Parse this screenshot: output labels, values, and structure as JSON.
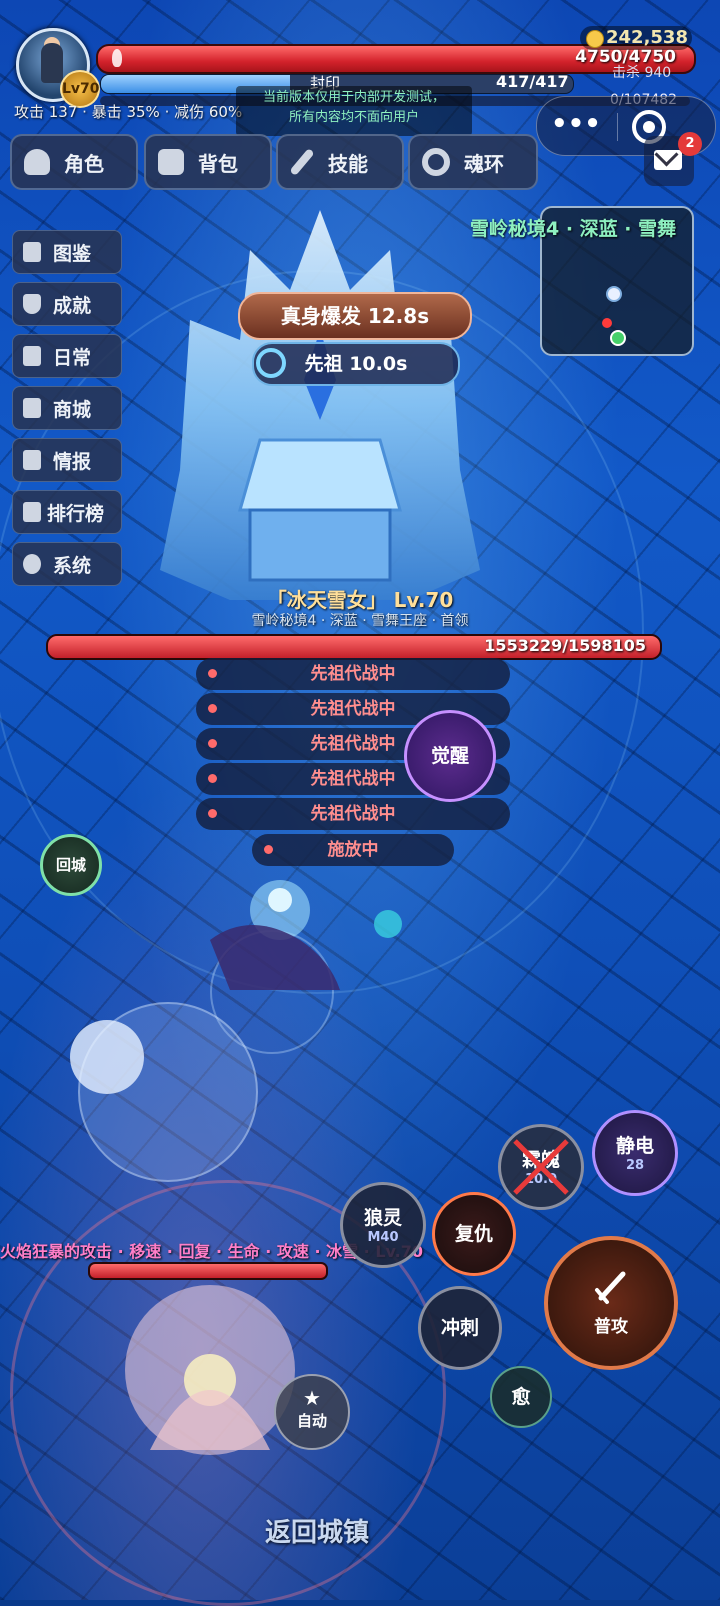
{
  "hud": {
    "level_badge": "Lv70",
    "hp_text": "4750/4750",
    "gold": "242,538",
    "kill_label": "击杀 940",
    "seal_label": "封印",
    "seal_value": "417/417",
    "seal_fraction": 0.4,
    "xp_text": "0/107482",
    "stats_text": "攻击 137  ·  暴击 35%  ·  减伤 60%",
    "notice_line1": "当前版本仅用于内部开发测试，",
    "notice_line2": "所有内容均不面向用户",
    "mail_badge": "2",
    "more_icon": "•••"
  },
  "tabs": [
    {
      "label": "角色",
      "icon": "person-icon"
    },
    {
      "label": "背包",
      "icon": "bag-icon"
    },
    {
      "label": "技能",
      "icon": "wand-icon"
    },
    {
      "label": "魂环",
      "icon": "ring-icon"
    }
  ],
  "left_menu": [
    {
      "label": "图鉴",
      "icon": "book-icon"
    },
    {
      "label": "成就",
      "icon": "trophy-icon"
    },
    {
      "label": "日常",
      "icon": "calendar-icon"
    },
    {
      "label": "商城",
      "icon": "shop-icon"
    },
    {
      "label": "情报",
      "icon": "notes-icon"
    },
    {
      "label": "排行榜",
      "icon": "ranking-icon"
    },
    {
      "label": "系统",
      "icon": "gear-icon"
    }
  ],
  "zone_name": "雪岭秘境4 · 深蓝 · 雪舞",
  "timers": {
    "burst": "真身爆发 12.8s",
    "ancestor": "先祖 10.0s"
  },
  "boss": {
    "name": "「冰天雪女」 Lv.70",
    "subtitle": "雪岭秘境4 · 深蓝 · 雪舞王座 · 首领",
    "hp_text": "1553229/1598105",
    "hp_fraction": 0.972
  },
  "status_list": [
    "先祖代战中",
    "先祖代战中",
    "先祖代战中",
    "先祖代战中",
    "先祖代战中"
  ],
  "casting_label": "施放中",
  "awaken_label": "觉醒",
  "return_city_label": "回城",
  "skills": {
    "soul": {
      "label": "霖魄",
      "sub": "10.0"
    },
    "static": {
      "label": "静电",
      "sub": "28"
    },
    "wolf": {
      "label": "狼灵",
      "sub": "M40"
    },
    "revenge": {
      "label": "复仇"
    },
    "attack": {
      "label": "普攻"
    },
    "dash": {
      "label": "冲刺"
    },
    "heal": {
      "label": "愈"
    },
    "auto": {
      "label": "自动"
    }
  },
  "buff_banner": "火焰狂暴的攻击 · 移速 · 回复 · 生命 · 攻速 · 冰雪 · Lv.70",
  "back_to_town": "返回城镇",
  "colors": {
    "hp": "#d3222b",
    "accent": "#8ef0c0",
    "awaken": "#c690ff"
  }
}
